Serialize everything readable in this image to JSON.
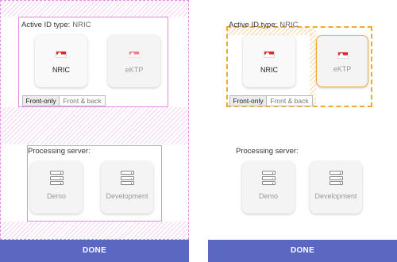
{
  "left": {
    "id_type_label": "Active ID type:",
    "id_type_value": "NRIC",
    "cards": [
      {
        "label": "NRIC",
        "icon": "singapore-flag-icon"
      },
      {
        "label": "eKTP",
        "icon": "singapore-flag-icon"
      }
    ],
    "toggle": [
      "Front-only",
      "Front & back"
    ],
    "server_label": "Processing server:",
    "servers": [
      {
        "label": "Demo",
        "icon": "server-icon"
      },
      {
        "label": "Development",
        "icon": "server-icon"
      }
    ],
    "done_label": "DONE"
  },
  "right": {
    "id_type_label": "Active ID type:",
    "id_type_value": "NRIC",
    "cards": [
      {
        "label": "NRIC",
        "icon": "singapore-flag-icon"
      },
      {
        "label": "eKTP",
        "icon": "singapore-flag-icon"
      }
    ],
    "toggle": [
      "Front-only",
      "Front & back"
    ],
    "server_label": "Processing server:",
    "servers": [
      {
        "label": "Demo",
        "icon": "server-icon"
      },
      {
        "label": "Development",
        "icon": "server-icon"
      }
    ],
    "done_label": "DONE"
  },
  "colors": {
    "done_button": "#5a68c2",
    "debug_outline_pink": "#e48be4",
    "debug_outline_orange": "#f0a830",
    "flag_red": "#e0262d"
  }
}
